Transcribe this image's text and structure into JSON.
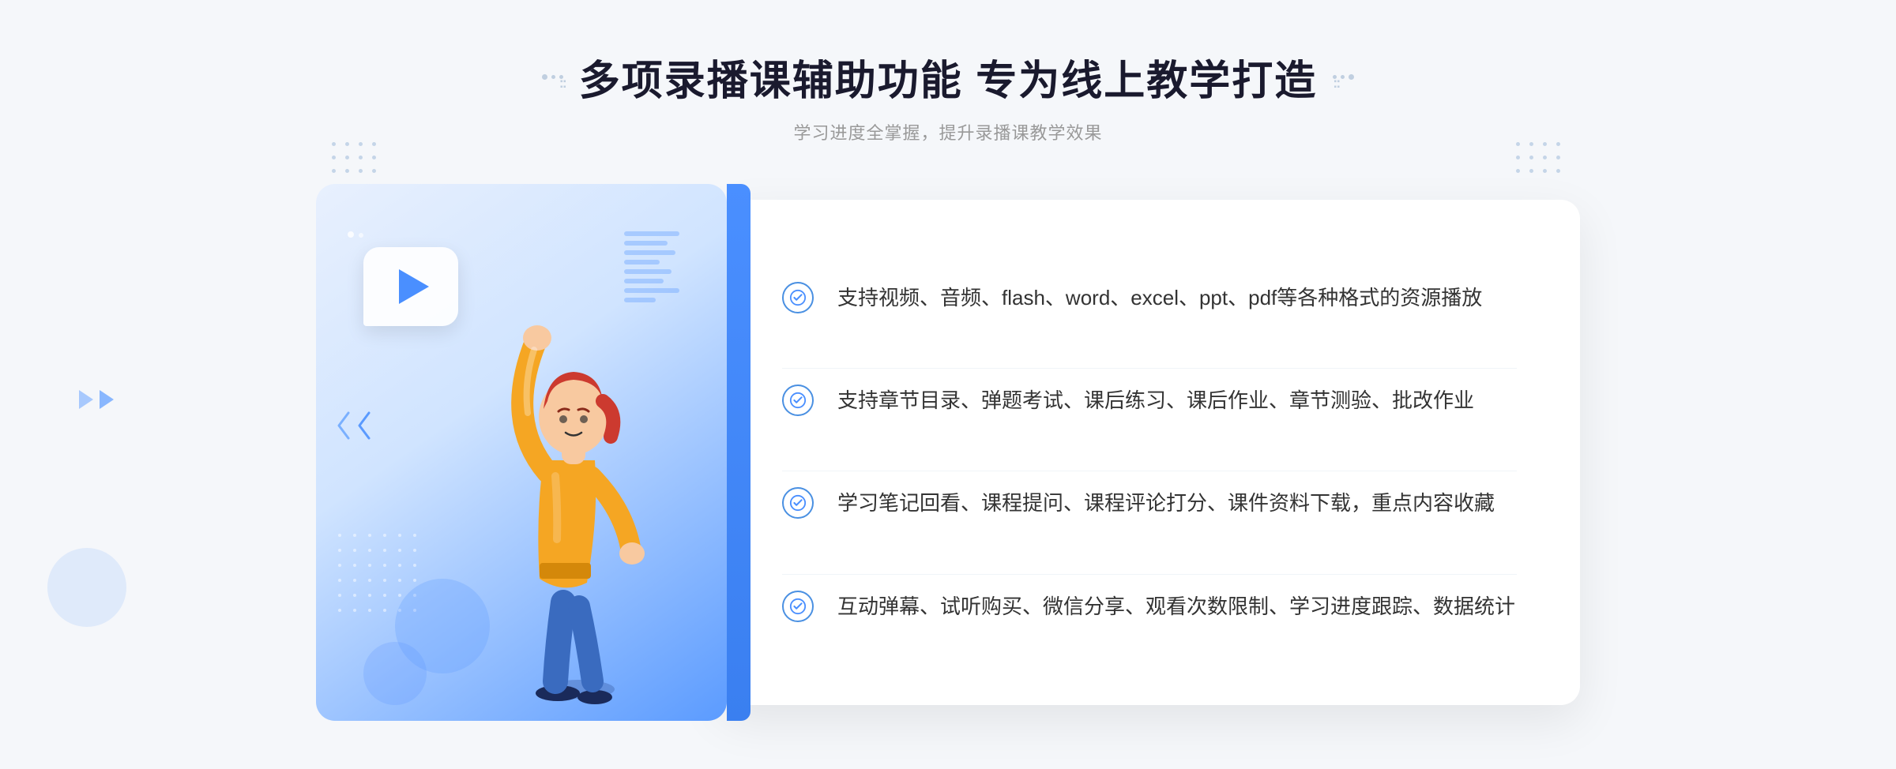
{
  "header": {
    "title": "多项录播课辅助功能 专为线上教学打造",
    "subtitle": "学习进度全掌握，提升录播课教学效果",
    "decorator_dots": "··::"
  },
  "features": [
    {
      "id": "feature-1",
      "text": "支持视频、音频、flash、word、excel、ppt、pdf等各种格式的资源播放"
    },
    {
      "id": "feature-2",
      "text": "支持章节目录、弹题考试、课后练习、课后作业、章节测验、批改作业"
    },
    {
      "id": "feature-3",
      "text": "学习笔记回看、课程提问、课程评论打分、课件资料下载，重点内容收藏"
    },
    {
      "id": "feature-4",
      "text": "互动弹幕、试听购买、微信分享、观看次数限制、学习进度跟踪、数据统计"
    }
  ],
  "colors": {
    "primary": "#4a8fff",
    "text_dark": "#1a1a2e",
    "text_medium": "#333333",
    "text_light": "#999999",
    "bg_light": "#f5f7fa",
    "card_bg": "#ffffff"
  }
}
